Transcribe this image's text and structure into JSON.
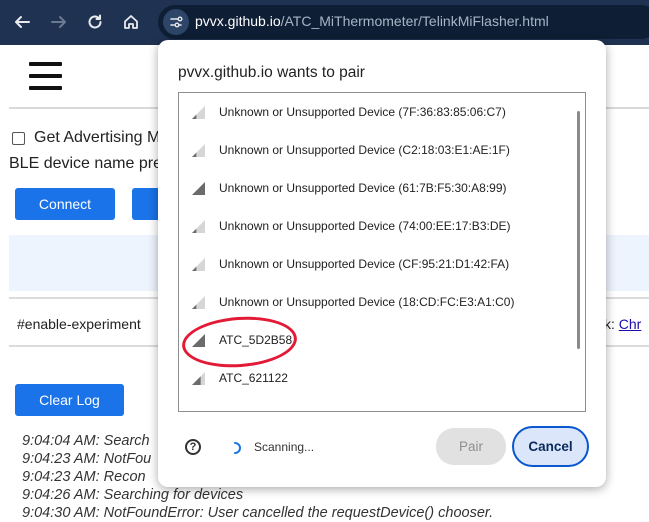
{
  "browser": {
    "url_host": "pvvx.github.io",
    "url_path": "/ATC_MiThermometer/TelinkMiFlasher.html"
  },
  "page": {
    "advertising_label": "Get Advertising M",
    "ble_name_label": "BLE device name pre",
    "connect_label": "Connect",
    "flag_text": "#enable-experiment",
    "flag_link_prefix": "k: ",
    "flag_link_text": "Chr",
    "clear_log_label": "Clear Log",
    "log_lines": [
      "9:04:04 AM: Search",
      "9:04:23 AM: NotFou",
      "9:04:23 AM: Recon",
      "9:04:26 AM: Searching for devices",
      "9:04:30 AM: NotFoundError: User cancelled the requestDevice() chooser."
    ]
  },
  "dialog": {
    "title": "pvvx.github.io wants to pair",
    "devices": [
      {
        "name": "Unknown or Unsupported Device (7F:36:83:85:06:C7)",
        "signal": 1
      },
      {
        "name": "Unknown or Unsupported Device (C2:18:03:E1:AE:1F)",
        "signal": 1
      },
      {
        "name": "Unknown or Unsupported Device (61:7B:F5:30:A8:99)",
        "signal": 3
      },
      {
        "name": "Unknown or Unsupported Device (74:00:EE:17:B3:DE)",
        "signal": 1
      },
      {
        "name": "Unknown or Unsupported Device (CF:95:21:D1:42:FA)",
        "signal": 1
      },
      {
        "name": "Unknown or Unsupported Device (18:CD:FC:E3:A1:C0)",
        "signal": 1
      },
      {
        "name": "ATC_5D2B58",
        "signal": 3
      },
      {
        "name": "ATC_621122",
        "signal": 2
      }
    ],
    "status": "Scanning...",
    "pair_label": "Pair",
    "cancel_label": "Cancel"
  },
  "colors": {
    "toolbar": "#1f3251",
    "accent": "#1a73e8",
    "annotation": "#e21a36"
  }
}
